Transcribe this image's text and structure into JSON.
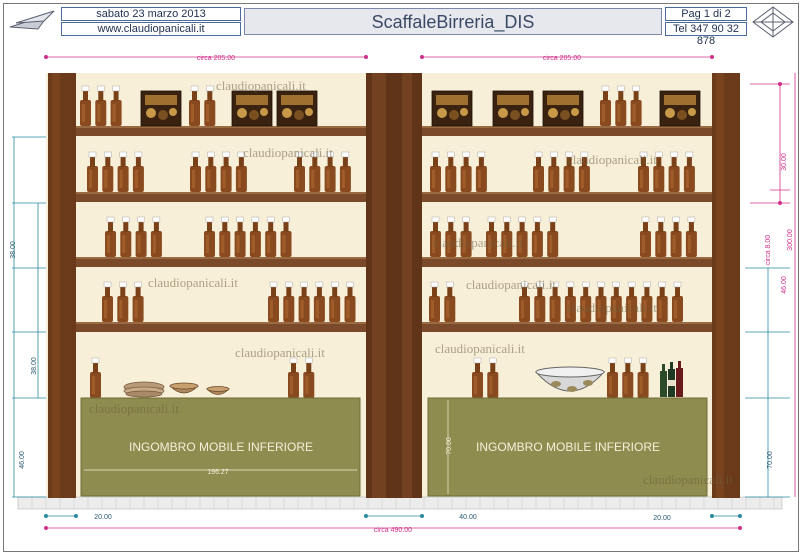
{
  "header": {
    "date": "sabato 23 marzo 2013",
    "website": "www.claudiopanicali.it",
    "title": "ScaffaleBirreria_DIS",
    "page": "Pag 1 di 2",
    "phone": "Tel 347 90 32 878"
  },
  "watermark": "claudiopanicali.it",
  "cabinet_label": "INGOMBRO MOBILE INFERIORE",
  "dimensions": {
    "top_left": "circa 205.00",
    "top_right": "circa 205.00",
    "total": "circa 490.00",
    "bottom_left": "20.00",
    "bottom_mid": "40.00",
    "bottom_right": "20.00",
    "left_38a": "38.00",
    "left_38b": "38.00",
    "left_46": "46.00",
    "right_30": "30.00",
    "right_8": "circa 8.00",
    "right_300": "300.00",
    "right_46": "46.00",
    "right_70": "70.00",
    "cab_width": "196.27",
    "cab_height": "70.00"
  },
  "colors": {
    "wall": "#f8efd8",
    "post": "#6b3a1a",
    "shelf": "#7a4a2a",
    "cabinet": "#8e8c4e",
    "bottle": "#8a4a20",
    "dim_magenta": "#d0308a",
    "dim_cyan": "#2a8aa0"
  }
}
